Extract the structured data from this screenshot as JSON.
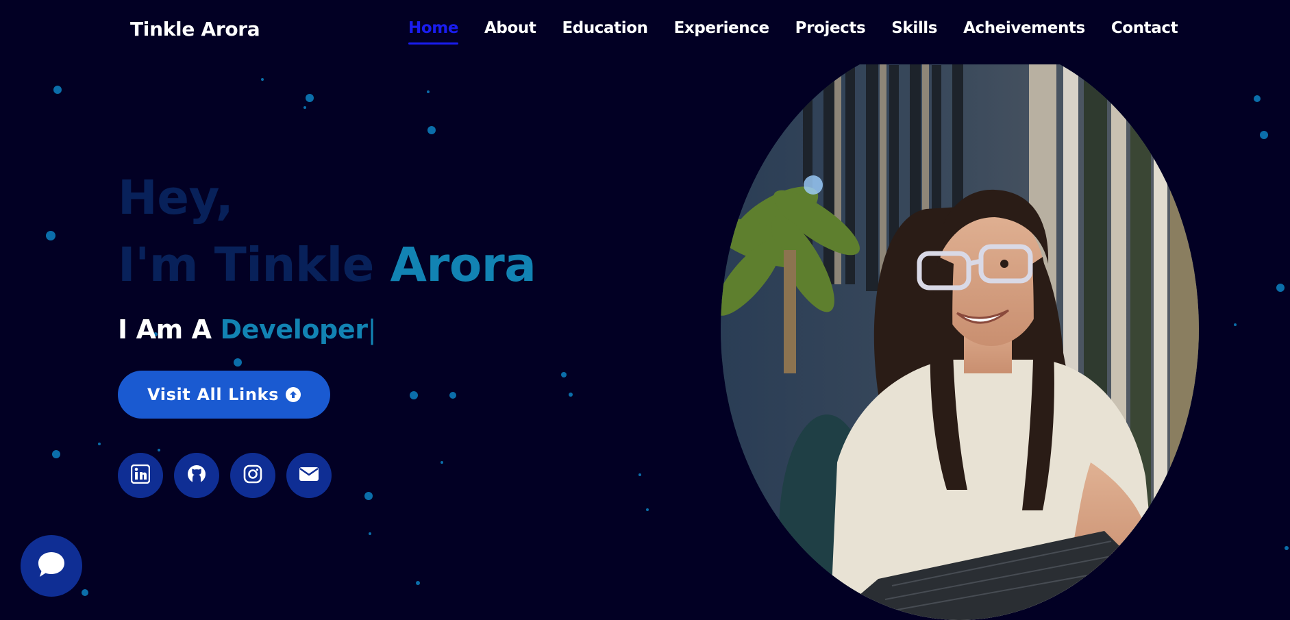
{
  "brand": "Tinkle Arora",
  "nav": {
    "items": [
      "Home",
      "About",
      "Education",
      "Experience",
      "Projects",
      "Skills",
      "Acheivements",
      "Contact"
    ],
    "active": "Home"
  },
  "hero": {
    "greeting": "Hey,",
    "intro_prefix": "I'm Tinkle",
    "intro_highlight": "Arora",
    "role_prefix": "I Am A",
    "role_typed": "Developer",
    "cursor": "|",
    "button_label": "Visit All Links",
    "button_icon": "arrow-up-circle-icon"
  },
  "socials": [
    {
      "name": "linkedin",
      "icon": "linkedin-icon"
    },
    {
      "name": "github",
      "icon": "github-icon"
    },
    {
      "name": "instagram",
      "icon": "instagram-icon"
    },
    {
      "name": "email",
      "icon": "envelope-icon"
    }
  ],
  "chat": {
    "icon": "chat-bubble-icon"
  },
  "colors": {
    "background": "#020024",
    "accent_blue": "#1a1df0",
    "cyan": "#1283b3",
    "dim_text": "#08215a",
    "button": "#1a5ad1",
    "social_bg": "#0f2e94",
    "particle": "#0b6eaa"
  }
}
